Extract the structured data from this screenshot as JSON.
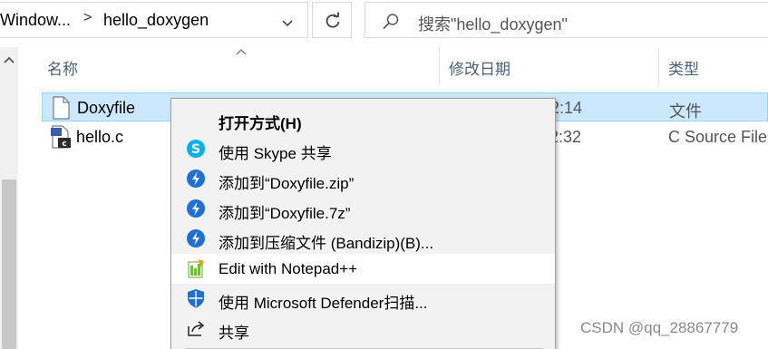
{
  "address": {
    "crumb_1": "Window...",
    "separator": ">",
    "crumb_2": "hello_doxygen"
  },
  "search": {
    "placeholder": "搜索\"hello_doxygen\""
  },
  "columns": {
    "name": "名称",
    "date_modified": "修改日期",
    "type": "类型"
  },
  "files": [
    {
      "name": "Doxyfile",
      "date": "2:14",
      "type": "文件",
      "icon": "text-file-icon"
    },
    {
      "name": "hello.c",
      "date": "2:32",
      "type": "C Source File",
      "icon": "c-source-file-icon"
    }
  ],
  "context_menu": {
    "items": [
      {
        "label": "打开方式(H)",
        "icon": "none"
      },
      {
        "label": "使用 Skype 共享",
        "icon": "skype-icon"
      },
      {
        "label": "添加到“Doxyfile.zip”",
        "icon": "bandizip-icon"
      },
      {
        "label": "添加到“Doxyfile.7z”",
        "icon": "bandizip-icon"
      },
      {
        "label": "添加到压缩文件 (Bandizip)(B)...",
        "icon": "bandizip-icon"
      },
      {
        "label": "Edit with Notepad++",
        "icon": "notepad-plus-plus-icon"
      },
      {
        "label": "使用 Microsoft Defender扫描...",
        "icon": "defender-shield-icon"
      },
      {
        "label": "共享",
        "icon": "share-icon"
      }
    ]
  },
  "watermark": "CSDN @qq_28867779",
  "colors": {
    "selection_bg": "#cce8ff",
    "selection_border": "#99d1ff",
    "menu_bg": "#f2f2f2",
    "menu_highlight": "#ffffff",
    "bandizip_blue": "#1f6fd6",
    "skype_blue": "#00aff0",
    "header_text": "#4c607a"
  }
}
